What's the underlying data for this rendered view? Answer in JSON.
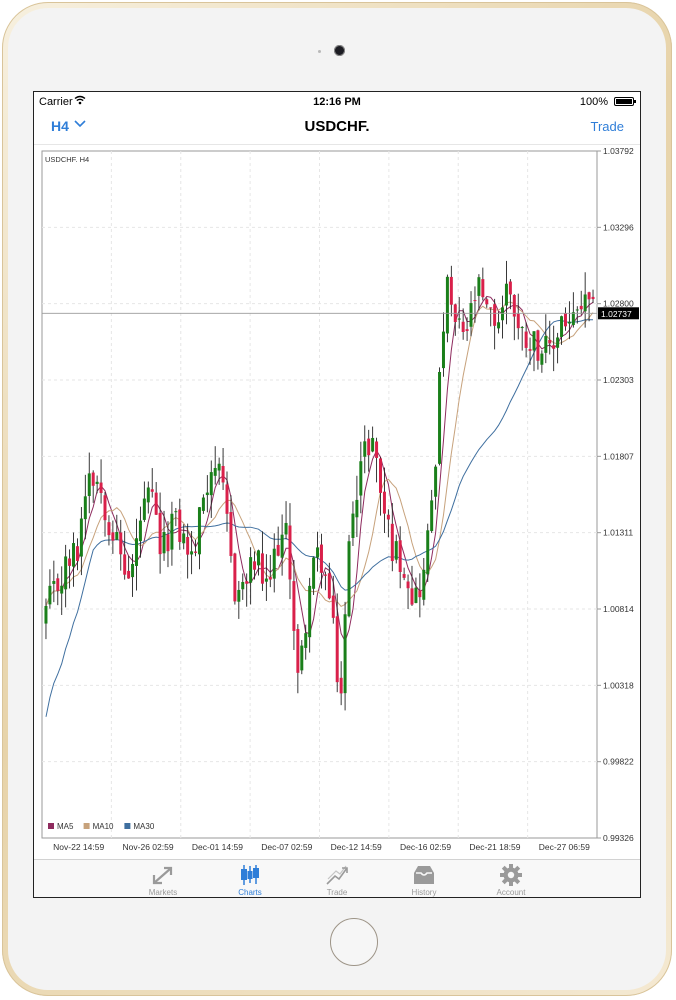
{
  "status_bar": {
    "carrier": "Carrier",
    "time": "12:16 PM",
    "battery": "100%"
  },
  "nav": {
    "timeframe": "H4",
    "title": "USDCHF.",
    "trade_label": "Trade"
  },
  "chart_data": {
    "type": "candlestick",
    "symbol_label": "USDCHF. H4",
    "current_price_label": "1.02737",
    "current_price": 1.02737,
    "ylim": [
      0.99326,
      1.03792
    ],
    "y_ticks": [
      "1.03792",
      "1.03296",
      "1.02800",
      "1.02303",
      "1.01807",
      "1.01311",
      "1.00814",
      "1.00318",
      "0.99822",
      "0.99326"
    ],
    "x_ticks": [
      "Nov-22 14:59",
      "Nov-26 02:59",
      "Dec-01 14:59",
      "Dec-07 02:59",
      "Dec-12 14:59",
      "Dec-16 02:59",
      "Dec-21 18:59",
      "Dec-27 06:59"
    ],
    "up_color": "#1a7f1a",
    "down_color": "#d9204a",
    "grid": true,
    "legend_position": "bottom-left",
    "legend": [
      {
        "name": "MA5",
        "color": "#8e2b5e"
      },
      {
        "name": "MA10",
        "color": "#c7a27c"
      },
      {
        "name": "MA30",
        "color": "#3f6f9f"
      }
    ],
    "anchors": [
      1.008,
      1.0095,
      1.011,
      1.012,
      1.0175,
      1.0165,
      1.014,
      1.0118,
      1.0098,
      1.014,
      1.0155,
      1.0115,
      1.014,
      1.0128,
      1.0112,
      1.0158,
      1.018,
      1.0148,
      1.0092,
      1.0098,
      1.0115,
      1.009,
      1.0125,
      1.0128,
      1.003,
      1.0095,
      1.012,
      1.0085,
      1.002,
      1.0145,
      1.0178,
      1.0195,
      1.015,
      1.012,
      1.0112,
      1.0088,
      1.0105,
      1.018,
      1.0292,
      1.0262,
      1.0262,
      1.029,
      1.027,
      1.027,
      1.0295,
      1.026,
      1.0258,
      1.0252,
      1.0245,
      1.0272,
      1.0265,
      1.028,
      1.0272
    ]
  },
  "tabs": [
    {
      "label": "Markets",
      "icon": "markets-icon"
    },
    {
      "label": "Charts",
      "icon": "charts-icon"
    },
    {
      "label": "Trade",
      "icon": "trade-icon"
    },
    {
      "label": "History",
      "icon": "history-icon"
    },
    {
      "label": "Account",
      "icon": "account-icon"
    }
  ],
  "active_tab": "Charts"
}
